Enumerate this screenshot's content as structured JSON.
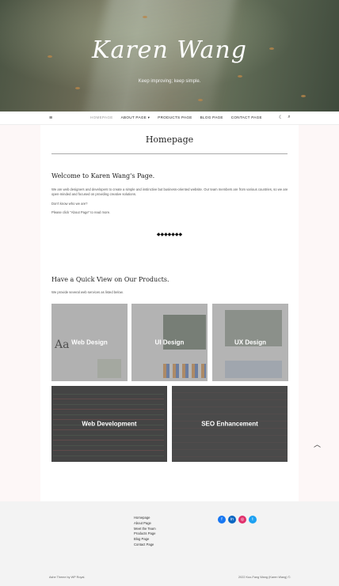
{
  "hero": {
    "title": "Karen Wang",
    "tagline": "Keep improving; keep simple."
  },
  "nav": {
    "menu_icon": "menu-icon",
    "items": [
      {
        "label": "HOMEPAGE",
        "active": true
      },
      {
        "label": "ABOUT PAGE ▾",
        "active": false
      },
      {
        "label": "PRODUCTS PAGE",
        "active": false
      },
      {
        "label": "BLOG PAGE",
        "active": false
      },
      {
        "label": "CONTACT PAGE",
        "active": false
      }
    ],
    "tools": [
      "dark-mode-icon",
      "search-icon"
    ]
  },
  "main": {
    "page_title": "Homepage",
    "welcome_heading": "Welcome to Karen Wang's Page.",
    "welcome_para": "We are web designers and developers to create a simple and instinctive but business-oriented website. Our team members are from various countries, so we are open-minded and focused on providing creative solutions.",
    "dont_know": "Don't know who we are?",
    "click_about": "Please click \"About Page\" to read more.",
    "divider": "◆◆◆◆◆◆◆",
    "products_heading": "Have a Quick View on Our Products.",
    "products_para": "We provide several web services as listed below.",
    "products": [
      {
        "label": "Web Design"
      },
      {
        "label": "UI Design"
      },
      {
        "label": "UX Design"
      },
      {
        "label": "Web Development"
      },
      {
        "label": "SEO Enhancement"
      }
    ]
  },
  "footer": {
    "links": [
      "Homepage",
      "About Page",
      "Meet the Team",
      "Products Page",
      "Blog Page",
      "Contact Page"
    ],
    "social": [
      {
        "icon": "facebook-icon",
        "glyph": "f",
        "color": "#1877f2"
      },
      {
        "icon": "linkedin-icon",
        "glyph": "in",
        "color": "#0a66c2"
      },
      {
        "icon": "instagram-icon",
        "glyph": "◎",
        "color": "#e1306c"
      },
      {
        "icon": "twitter-icon",
        "glyph": "t",
        "color": "#1da1f2"
      }
    ],
    "credit": "Ashe Theme by WP Royal.",
    "copyright": "2022 Kuo-Fang Wang (Karen Wang) ©."
  },
  "scroll_top": "︿"
}
